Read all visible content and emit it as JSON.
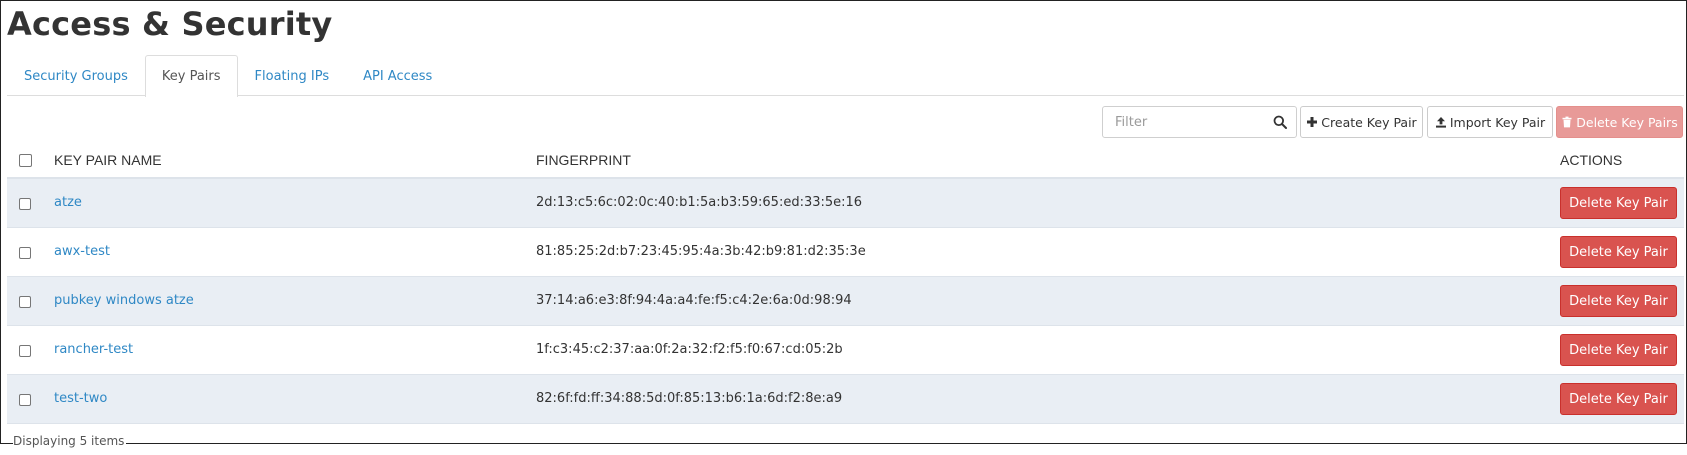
{
  "page": {
    "title": "Access & Security"
  },
  "tabs": [
    {
      "label": "Security Groups",
      "active": false
    },
    {
      "label": "Key Pairs",
      "active": true
    },
    {
      "label": "Floating IPs",
      "active": false
    },
    {
      "label": "API Access",
      "active": false
    }
  ],
  "toolbar": {
    "filter_placeholder": "Filter",
    "create_label": "Create Key Pair",
    "import_label": "Import Key Pair",
    "delete_all_label": "Delete Key Pairs"
  },
  "table": {
    "headers": {
      "name": "KEY PAIR NAME",
      "fingerprint": "FINGERPRINT",
      "actions": "ACTIONS"
    },
    "rows": [
      {
        "name": "atze",
        "fingerprint": "2d:13:c5:6c:02:0c:40:b1:5a:b3:59:65:ed:33:5e:16",
        "action": "Delete Key Pair"
      },
      {
        "name": "awx-test",
        "fingerprint": "81:85:25:2d:b7:23:45:95:4a:3b:42:b9:81:d2:35:3e",
        "action": "Delete Key Pair"
      },
      {
        "name": "pubkey windows atze",
        "fingerprint": "37:14:a6:e3:8f:94:4a:a4:fe:f5:c4:2e:6a:0d:98:94",
        "action": "Delete Key Pair"
      },
      {
        "name": "rancher-test",
        "fingerprint": "1f:c3:45:c2:37:aa:0f:2a:32:f2:f5:f0:67:cd:05:2b",
        "action": "Delete Key Pair"
      },
      {
        "name": "test-two",
        "fingerprint": "82:6f:fd:ff:34:88:5d:0f:85:13:b6:1a:6d:f2:8e:a9",
        "action": "Delete Key Pair"
      }
    ]
  },
  "footer": {
    "count_text": "Displaying 5 items"
  },
  "icons": {
    "search": "search-icon",
    "create": "plus-icon",
    "import": "upload-icon",
    "delete": "trash-icon"
  },
  "colors": {
    "link": "#2f88c5",
    "danger": "#d9534f",
    "danger_disabled": "#e89a98",
    "row_stripe": "#e9eef4"
  }
}
